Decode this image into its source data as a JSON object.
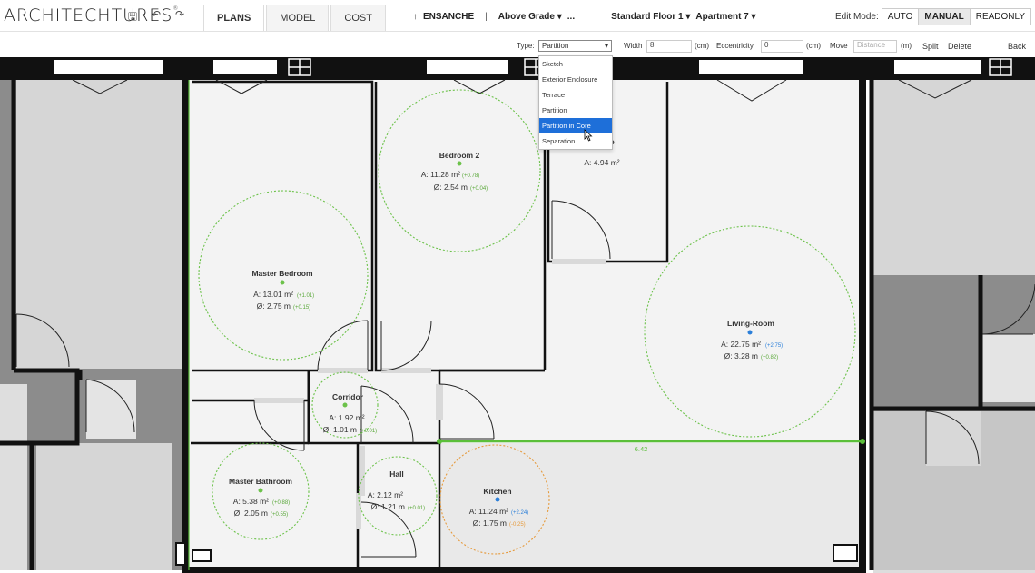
{
  "app": {
    "logo": "ARCHITECHTURES",
    "logo_mark": "®"
  },
  "toolbar": {
    "icons": [
      "save-icon",
      "undo-icon",
      "redo-icon"
    ],
    "icon_glyphs": [
      "🖫",
      "↶",
      "↷"
    ]
  },
  "tabs": [
    {
      "label": "PLANS",
      "active": true
    },
    {
      "label": "MODEL",
      "active": false
    },
    {
      "label": "COST",
      "active": false
    }
  ],
  "breadcrumb": {
    "up_icon": "↑",
    "project": "ENSANCHE",
    "sep": "|",
    "level": "Above Grade ▾",
    "more": "...",
    "floor": "Standard Floor 1 ▾",
    "unit": "Apartment 7 ▾"
  },
  "edit_mode": {
    "label": "Edit Mode:",
    "options": [
      "AUTO",
      "MANUAL",
      "READONLY"
    ],
    "active": "MANUAL"
  },
  "properties": {
    "type_label": "Type:",
    "type_value": "Partition",
    "type_arrow": "▾",
    "width_label": "Width",
    "width_value": "8",
    "width_unit": "(cm)",
    "ecc_label": "Eccentricity",
    "ecc_value": "0",
    "ecc_unit": "(cm)",
    "move_label": "Move",
    "move_placeholder": "Distance",
    "move_unit": "(m)",
    "split": "Split",
    "delete": "Delete",
    "back": "Back"
  },
  "type_options": [
    "Sketch",
    "Exterior Enclosure",
    "Terrace",
    "Partition",
    "Partition in Core",
    "Separation"
  ],
  "type_hovered": "Partition in Core",
  "rooms": {
    "bedroom2": {
      "name": "Bedroom 2",
      "area": "A: 11.28 m²",
      "area_delta": "(+0.78)",
      "dia": "Ø: 2.54 m",
      "dia_delta": "(+0.04)"
    },
    "small_room": {
      "name_suffix": "e",
      "area": "A: 4.94 m²"
    },
    "master_bedroom": {
      "name": "Master Bedroom",
      "area": "A: 13.01 m²",
      "area_delta": "(+1.01)",
      "dia": "Ø: 2.75 m",
      "dia_delta": "(+0.15)"
    },
    "living_room": {
      "name": "Living-Room",
      "area": "A: 22.75 m²",
      "area_delta": "(+2.75)",
      "dia": "Ø: 3.28 m",
      "dia_delta": "(+0.82)"
    },
    "corridor": {
      "name": "Corridor",
      "area": "A: 1.92 m²",
      "dia": "Ø: 1.01 m",
      "dia_delta": "(+0.01)"
    },
    "master_bathroom": {
      "name": "Master Bathroom",
      "area": "A: 5.38 m²",
      "area_delta": "(+0.88)",
      "dia": "Ø: 2.05 m",
      "dia_delta": "(+0.55)"
    },
    "hall": {
      "name": "Hall",
      "area": "A: 2.12 m²",
      "dia": "Ø: 1.21 m",
      "dia_delta": "(+0.01)"
    },
    "kitchen": {
      "name": "Kitchen",
      "area": "A: 11.24 m²",
      "area_delta": "(+2.24)",
      "dia": "Ø: 1.75 m",
      "dia_delta": "(-0.25)"
    }
  },
  "selected_wall": {
    "length_label": "6.42"
  },
  "colors": {
    "wall": "#111111",
    "selection": "#5bbf3a",
    "room_fill": "#f3f3f3",
    "outside": "#8a8a8a",
    "circle_green": "#6cc24a",
    "circle_orange": "#e69a3c",
    "dot_blue": "#2b7fd9",
    "dropdown_highlight": "#1e6fd9"
  }
}
